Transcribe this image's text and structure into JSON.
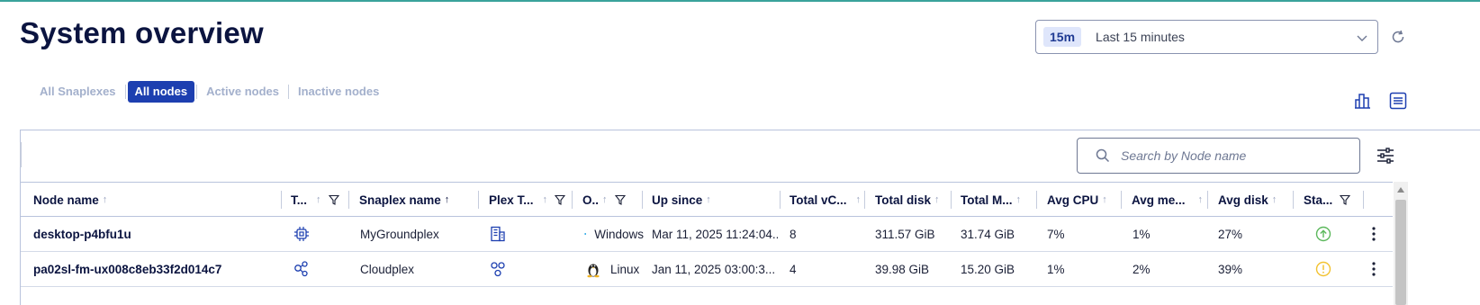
{
  "page": {
    "title": "System overview"
  },
  "time_range": {
    "badge": "15m",
    "label": "Last 15 minutes"
  },
  "tabs": [
    {
      "label": "All Snaplexes",
      "active": false
    },
    {
      "label": "All nodes",
      "active": true
    },
    {
      "label": "Active nodes",
      "active": false
    },
    {
      "label": "Inactive nodes",
      "active": false
    }
  ],
  "search": {
    "placeholder": "Search by Node name"
  },
  "columns": [
    {
      "label": "Node name",
      "sort": "up"
    },
    {
      "label": "T...",
      "sort": "up",
      "filter": true
    },
    {
      "label": "Snaplex name",
      "sort": "up-active"
    },
    {
      "label": "Plex T...",
      "sort": "up",
      "filter": true
    },
    {
      "label": "O..",
      "sort": "up",
      "filter": true
    },
    {
      "label": "Up since",
      "sort": "up"
    },
    {
      "label": "Total vC...",
      "sort": "up"
    },
    {
      "label": "Total disk",
      "sort": "up"
    },
    {
      "label": "Total M...",
      "sort": "up"
    },
    {
      "label": "Avg CPU",
      "sort": "up"
    },
    {
      "label": "Avg me...",
      "sort": "up"
    },
    {
      "label": "Avg disk",
      "sort": "up"
    },
    {
      "label": "Sta...",
      "filter": true
    }
  ],
  "rows": [
    {
      "node_name": "desktop-p4bfu1u",
      "type_icon": "chip-icon",
      "snaplex_name": "MyGroundplex",
      "plex_type_icon": "building-icon",
      "os_icon": "windows-icon",
      "os": "Windows",
      "up_since": "Mar 11, 2025 11:24:04...",
      "total_vcpu": "8",
      "total_disk": "311.57 GiB",
      "total_mem": "31.74 GiB",
      "avg_cpu": "7%",
      "avg_mem": "1%",
      "avg_disk": "27%",
      "status_icon": "status-up-icon",
      "status_color": "#5cb85c"
    },
    {
      "node_name": "pa02sl-fm-ux008c8eb33f2d014c7",
      "type_icon": "cloud-nodes-icon",
      "snaplex_name": "Cloudplex",
      "plex_type_icon": "cloudplex-icon",
      "os_icon": "linux-icon",
      "os": "Linux",
      "up_since": "Jan 11, 2025 03:00:3...",
      "total_vcpu": "4",
      "total_disk": "39.98 GiB",
      "total_mem": "15.20 GiB",
      "avg_cpu": "1%",
      "avg_mem": "2%",
      "avg_disk": "39%",
      "status_icon": "status-warning-icon",
      "status_color": "#f2c230"
    }
  ],
  "colors": {
    "accent": "#1d3fb0",
    "title": "#0b1440",
    "top_line": "#3aa39b"
  }
}
